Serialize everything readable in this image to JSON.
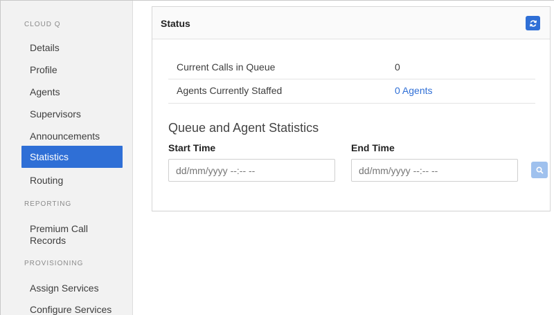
{
  "sidebar": {
    "section_cloud": "CLOUD Q",
    "items_cloud": [
      "Details",
      "Profile",
      "Agents",
      "Supervisors",
      "Announcements",
      "Statistics",
      "Routing"
    ],
    "section_reporting": "REPORTING",
    "premium_line1": "Premium Call",
    "premium_line2": "Records",
    "section_provisioning": "PROVISIONING",
    "items_provisioning": [
      "Assign Services",
      "Configure Services"
    ],
    "active_item": "Statistics"
  },
  "panel": {
    "title": "Status",
    "rows": [
      {
        "label": "Current Calls in Queue",
        "value": "0"
      },
      {
        "label": "Agents Currently Staffed",
        "value": "0 Agents"
      }
    ],
    "stats_title": "Queue and Agent Statistics",
    "start_label": "Start Time",
    "end_label": "End Time",
    "start_placeholder": "dd/mm/yyyy --:-- --",
    "end_placeholder": "dd/mm/yyyy --:-- --"
  },
  "icons": {
    "refresh": "refresh-icon",
    "search": "search-icon"
  },
  "colors": {
    "accent": "#2f6fd6",
    "search_button": "#9fc1ee",
    "sidebar_bg": "#f2f2f2"
  }
}
